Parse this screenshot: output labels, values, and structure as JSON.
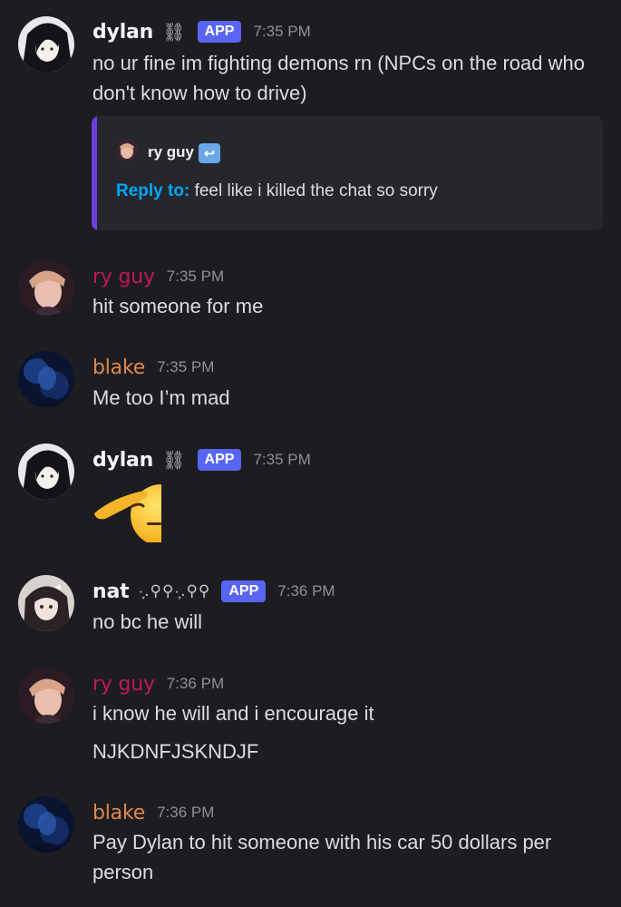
{
  "colors": {
    "background": "#1c1c21",
    "username_default": "#f2f3f5",
    "username_ryguy": "#c2185b",
    "username_blake": "#e0894a",
    "app_badge": "#5865f2",
    "timestamp": "#8f919a",
    "reply_label": "#00a8fc",
    "embed_bar": "#6b3fdc",
    "embed_bg": "#26272d"
  },
  "messages": [
    {
      "username": "dylan",
      "decoration": "⛓",
      "badge": "APP",
      "time": "7:35 PM",
      "lines": [
        "no ur fine im fighting demons rn (NPCs on the road who don't know how to drive)"
      ],
      "embed": {
        "author": "ry guy",
        "author_icon": "↩",
        "reply_label": "Reply to:",
        "reply_text": "feel like i killed the chat so sorry"
      }
    },
    {
      "username": "ry guy",
      "time": "7:35 PM",
      "lines": [
        "hit someone for me"
      ]
    },
    {
      "username": "blake",
      "time": "7:35 PM",
      "lines": [
        "Me too I’m mad"
      ]
    },
    {
      "username": "dylan",
      "decoration": "⛓",
      "badge": "APP",
      "time": "7:35 PM",
      "emoji": "saluting-face-emoji"
    },
    {
      "username": "nat",
      "decoration": "·͙.⚲⚲·͙.⚲⚲",
      "badge": "APP",
      "time": "7:36 PM",
      "lines": [
        "no bc he will"
      ]
    },
    {
      "username": "ry guy",
      "time": "7:36 PM",
      "lines": [
        "i know he will and i encourage it",
        "NJKDNFJSKNDJF"
      ]
    },
    {
      "username": "blake",
      "time": "7:36 PM",
      "lines": [
        "Pay Dylan to hit someone with his car 50 dollars per person"
      ]
    }
  ]
}
